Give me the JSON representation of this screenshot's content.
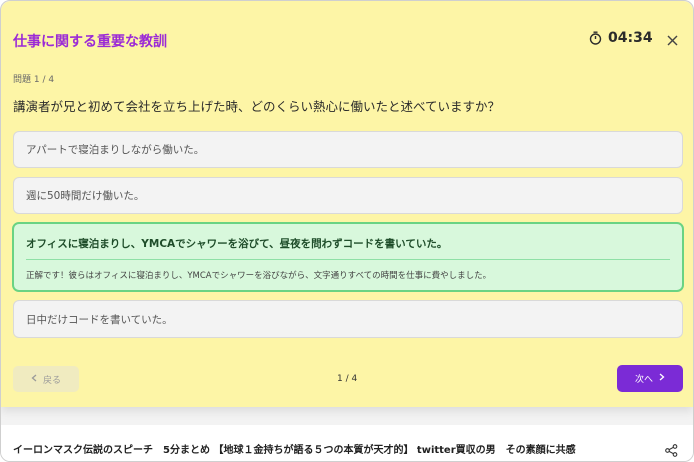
{
  "quiz": {
    "title": "仕事に関する重要な教訓",
    "timer": "04:34",
    "question_number": "問題 1 / 4",
    "question": "講演者が兄と初めて会社を立ち上げた時、どのくらい熱心に働いたと述べていますか？",
    "options": [
      {
        "text": "アパートで寝泊まりしながら働いた。"
      },
      {
        "text": "週に50時間だけ働いた。"
      },
      {
        "text": "オフィスに寝泊まりし、YMCAでシャワーを浴びて、昼夜を問わずコードを書いていた。",
        "state": "correct"
      },
      {
        "text": "日中だけコードを書いていた。"
      }
    ],
    "feedback": "正解です！彼らはオフィスに寝泊まりし、YMCAでシャワーを浴びながら、文字通りすべての時間を仕事に費やしました。",
    "back_label": "戻る",
    "pager": "1 / 4",
    "next_label": "次へ"
  },
  "video": {
    "title": "イーロンマスク伝説のスピーチ　5分まとめ 【地球１金持ちが語る５つの本質が天才的】 twitter買収の男　その素顔に共感"
  },
  "colors": {
    "accent_purple": "#7b2bd6",
    "title_purple": "#9b2ad6",
    "quiz_background": "#fdf5a6",
    "correct_background": "#d8f8dc",
    "correct_border": "#6ad383"
  },
  "icons": [
    "stopwatch-icon",
    "close-icon",
    "chevron-left-icon",
    "chevron-right-icon",
    "share-icon"
  ]
}
